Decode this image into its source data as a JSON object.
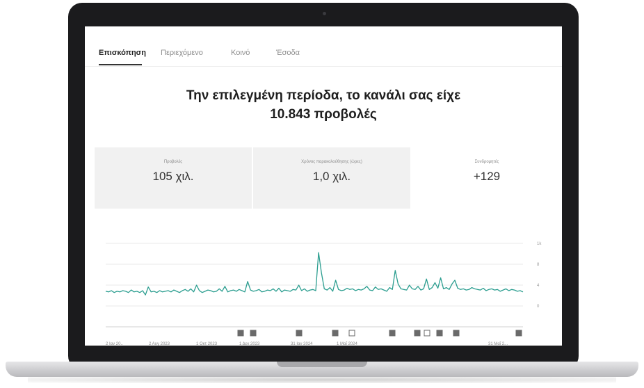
{
  "tabs": [
    {
      "label": "Επισκόπηση",
      "active": true
    },
    {
      "label": "Περιεχόμενο",
      "active": false
    },
    {
      "label": "Κοινό",
      "active": false
    },
    {
      "label": "Έσοδα",
      "active": false
    }
  ],
  "headline": {
    "line1": "Την επιλεγμένη περίοδα, το κανάλι σας είχε",
    "line2": "10.843 προβολές"
  },
  "metrics": [
    {
      "label": "Προβολές",
      "value": "105 χιλ."
    },
    {
      "label": "Χρόνος παρακολούθησης (ώρες)",
      "value": "1,0 χιλ."
    },
    {
      "label": "Συνδρομητές",
      "value": "+129"
    }
  ],
  "chart_data": {
    "type": "line",
    "y_ticks": [
      "1k",
      "8",
      "4",
      "0"
    ],
    "x_tick_labels": [
      "2 Ιαν 20..",
      "2 Αυγ 2023",
      "1 Οκτ 2023",
      "1 Δεκ 2023",
      "31 Ιαν 2024",
      "1 Μαΐ 2024",
      "31 Μαΐ 2..."
    ],
    "series": [
      {
        "color": "#2a9d8f",
        "values": [
          4.2,
          4.1,
          4.3,
          4.0,
          4.2,
          4.1,
          4.3,
          4.2,
          4.0,
          4.4,
          4.1,
          4.2,
          4.0,
          4.3,
          3.6,
          4.9,
          4.1,
          4.2,
          4.0,
          4.3,
          4.1,
          4.2,
          4.3,
          4.1,
          4.4,
          4.2,
          4.0,
          4.3,
          4.5,
          4.2,
          4.6,
          4.1,
          5.2,
          4.3,
          4.0,
          4.2,
          4.4,
          4.3,
          4.1,
          4.2,
          4.6,
          4.2,
          5.0,
          4.1,
          4.3,
          4.4,
          4.2,
          4.5,
          4.3,
          4.1,
          5.8,
          4.4,
          4.2,
          4.3,
          4.5,
          4.1,
          4.2,
          4.4,
          4.3,
          4.6,
          4.2,
          4.7,
          4.1,
          4.4,
          4.3,
          4.2,
          4.5,
          4.4,
          5.2,
          4.3,
          4.6,
          4.2,
          4.4,
          4.5,
          4.3,
          10.5,
          7.2,
          4.6,
          4.4,
          4.8,
          4.2,
          6.0,
          4.5,
          4.3,
          4.4,
          4.7,
          4.5,
          4.6,
          4.3,
          4.5,
          4.4,
          4.6,
          5.0,
          4.4,
          4.3,
          4.9,
          4.5,
          4.6,
          4.4,
          4.2,
          4.8,
          4.5,
          7.6,
          5.4,
          4.6,
          4.5,
          4.4,
          5.2,
          4.6,
          4.5,
          5.0,
          4.4,
          4.6,
          6.2,
          4.5,
          4.8,
          5.6,
          4.7,
          6.4,
          4.6,
          4.8,
          4.5,
          5.4,
          6.0,
          4.7,
          4.5,
          4.6,
          4.4,
          4.5,
          4.8,
          4.6,
          4.5,
          4.4,
          4.7,
          4.3,
          4.5,
          4.6,
          4.4,
          4.5,
          4.2,
          4.4,
          4.6,
          4.3,
          4.5,
          4.4,
          4.2,
          4.3,
          4.1
        ]
      }
    ],
    "ylim": [
      0,
      12
    ],
    "grid": true
  },
  "markers": {
    "count": 12
  }
}
